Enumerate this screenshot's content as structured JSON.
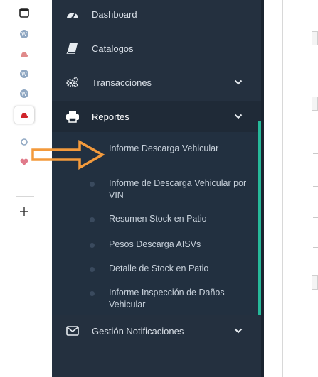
{
  "strip": {
    "icons": [
      "tab-icon",
      "wordpress-icon",
      "car-icon",
      "wordpress-icon",
      "wordpress-icon",
      "car-icon",
      "extension-icon",
      "heart-icon",
      "plus-icon"
    ]
  },
  "sidebar": {
    "items": [
      {
        "label": "Dashboard",
        "icon": "dashboard-icon"
      },
      {
        "label": "Catalogos",
        "icon": "book-icon"
      },
      {
        "label": "Transacciones",
        "icon": "cogs-icon",
        "chevron": true
      },
      {
        "label": "Reportes",
        "icon": "printer-icon",
        "chevron": true,
        "open": true
      },
      {
        "label": "Gestión Notificaciones",
        "icon": "envelope-icon",
        "chevron": true
      }
    ],
    "reportes_sub": [
      "Informe Descarga Vehicular",
      "Informe de Descarga Vehicular por VIN",
      "Resumen Stock en Patio",
      "Pesos Descarga AISVs",
      "Detalle de Stock en Patio",
      "Informe Inspección de Daños Vehicular"
    ]
  },
  "colors": {
    "sidebar_bg": "#24303f",
    "active_accent": "#26b99a",
    "annotation_arrow": "#f39a3c"
  }
}
